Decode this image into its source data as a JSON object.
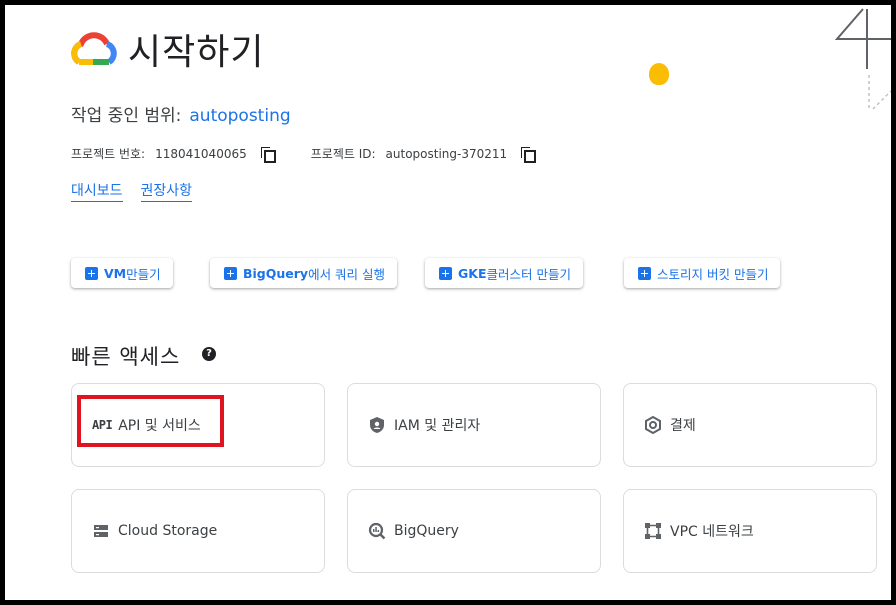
{
  "header": {
    "title": "시작하기"
  },
  "scope": {
    "label": "작업 중인 범위:",
    "project": "autoposting"
  },
  "ids": {
    "number_label": "프로젝트 번호:",
    "number_value": "118041040065",
    "id_label": "프로젝트 ID:",
    "id_value": "autoposting-370211"
  },
  "links": [
    "대시보드",
    "권장사항"
  ],
  "actions": [
    {
      "bold": "VM",
      "label": " 만들기"
    },
    {
      "bold": "BigQuery",
      "label": "에서 쿼리 실행"
    },
    {
      "bold": "GKE",
      "label": " 클러스터 만들기"
    },
    {
      "bold": "",
      "label": "스토리지 버킷 만들기"
    }
  ],
  "quick_access": {
    "title": "빠른 액세스",
    "help_glyph": "?",
    "cards": [
      {
        "label": "API 및 서비스",
        "icon": "api-icon",
        "icon_text": "API"
      },
      {
        "label": "IAM 및 관리자",
        "icon": "shield-icon"
      },
      {
        "label": "결제",
        "icon": "billing-icon"
      },
      {
        "label": "Cloud Storage",
        "icon": "storage-icon"
      },
      {
        "label": "BigQuery",
        "icon": "bigquery-icon"
      },
      {
        "label": "VPC 네트워크",
        "icon": "vpc-network-icon"
      }
    ]
  },
  "colors": {
    "accent": "#1a73e8",
    "highlight": "#e0141e",
    "text": "#202124"
  }
}
